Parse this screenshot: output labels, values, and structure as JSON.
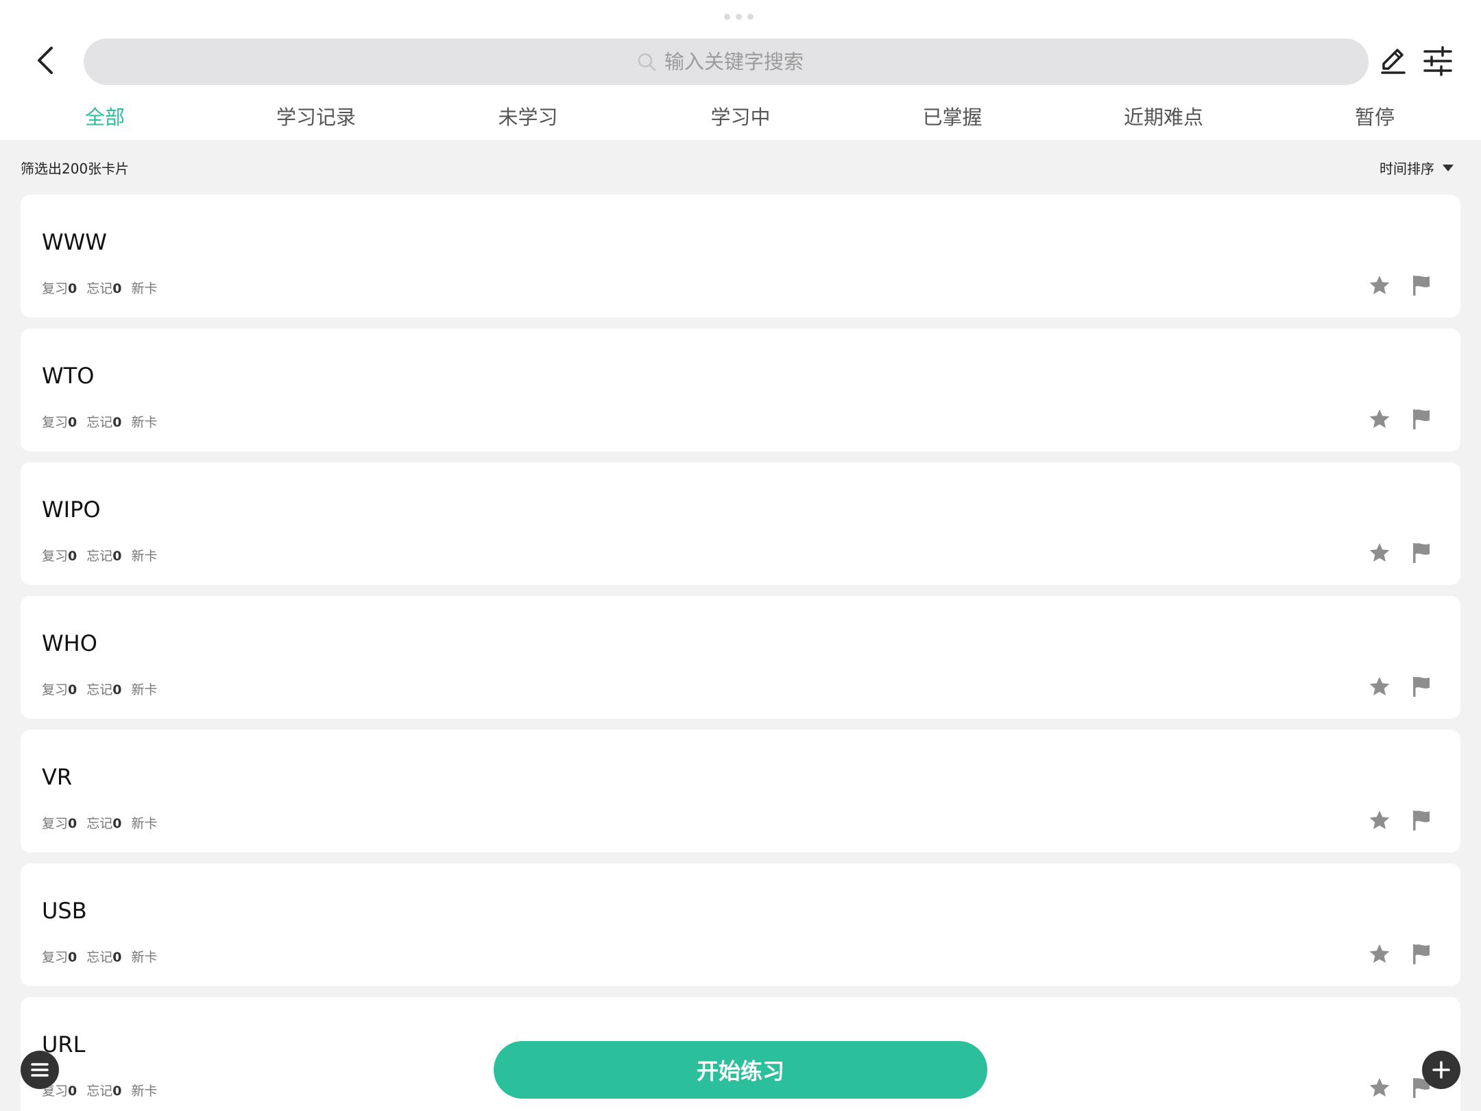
{
  "search": {
    "placeholder": "输入关键字搜索"
  },
  "tabs": [
    {
      "label": "全部",
      "active": true
    },
    {
      "label": "学习记录",
      "active": false
    },
    {
      "label": "未学习",
      "active": false
    },
    {
      "label": "学习中",
      "active": false
    },
    {
      "label": "已掌握",
      "active": false
    },
    {
      "label": "近期难点",
      "active": false
    },
    {
      "label": "暂停",
      "active": false
    }
  ],
  "filter": {
    "count_text": "筛选出200张卡片",
    "sort_label": "时间排序"
  },
  "cards": [
    {
      "title": "WWW",
      "review_label": "复习",
      "review_count": "0",
      "forget_label": "忘记",
      "forget_count": "0",
      "status": "新卡"
    },
    {
      "title": "WTO",
      "review_label": "复习",
      "review_count": "0",
      "forget_label": "忘记",
      "forget_count": "0",
      "status": "新卡"
    },
    {
      "title": "WIPO",
      "review_label": "复习",
      "review_count": "0",
      "forget_label": "忘记",
      "forget_count": "0",
      "status": "新卡"
    },
    {
      "title": "WHO",
      "review_label": "复习",
      "review_count": "0",
      "forget_label": "忘记",
      "forget_count": "0",
      "status": "新卡"
    },
    {
      "title": "VR",
      "review_label": "复习",
      "review_count": "0",
      "forget_label": "忘记",
      "forget_count": "0",
      "status": "新卡"
    },
    {
      "title": "USB",
      "review_label": "复习",
      "review_count": "0",
      "forget_label": "忘记",
      "forget_count": "0",
      "status": "新卡"
    },
    {
      "title": "URL",
      "review_label": "复习",
      "review_count": "0",
      "forget_label": "忘记",
      "forget_count": "0",
      "status": "新卡"
    }
  ],
  "start_button": {
    "label": "开始练习"
  },
  "colors": {
    "accent": "#2bbf9c",
    "icon_gray": "#8e8e8e",
    "fab": "#333333"
  },
  "icons": {
    "back": "chevron-left-icon",
    "search": "search-icon",
    "edit": "pencil-icon",
    "filter": "sliders-icon",
    "star": "star-icon",
    "flag": "flag-icon",
    "menu": "menu-icon",
    "add": "plus-icon"
  }
}
